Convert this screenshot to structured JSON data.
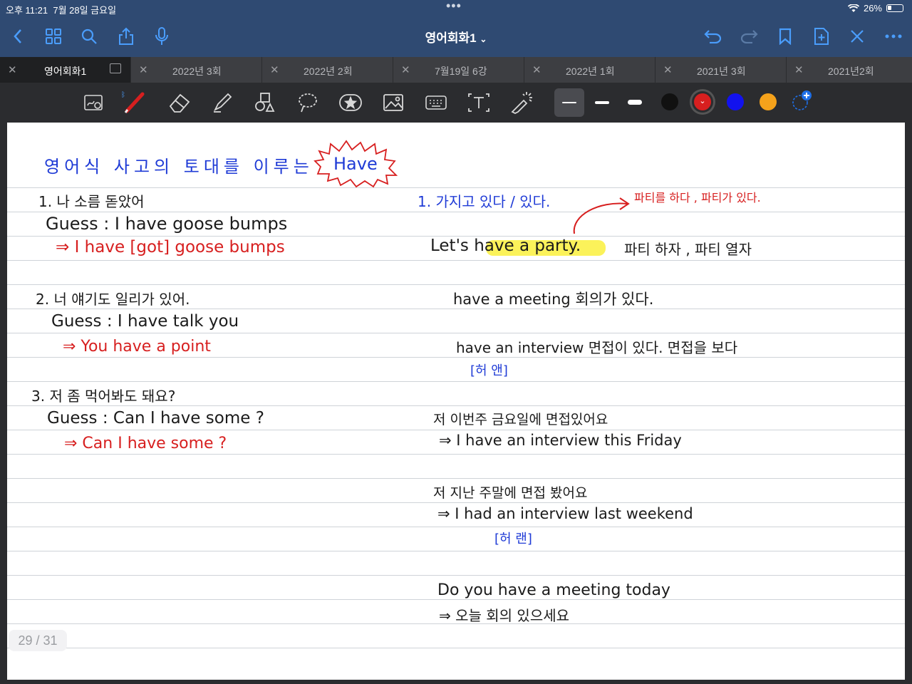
{
  "status": {
    "time": "오후 11:21",
    "date": "7월 28일 금요일",
    "battery": "26%",
    "battery_level": 0.26
  },
  "toolbar": {
    "title": "영어회화1",
    "title_chevron": "⌄"
  },
  "tabs": [
    {
      "label": "영어회화1",
      "active": true
    },
    {
      "label": "2022년 3회"
    },
    {
      "label": "2022년 2회"
    },
    {
      "label": "7월19일 6강"
    },
    {
      "label": "2022년 1회"
    },
    {
      "label": "2021년 3회"
    },
    {
      "label": "2021년2회"
    }
  ],
  "pen_colors": [
    "#111111",
    "#d71f1f",
    "#1212ee",
    "#f5a21b"
  ],
  "note": {
    "title": "영어식 사고의 토대를 이루는",
    "title_badge": "Have",
    "left": [
      {
        "q": "1. 나 소름 돋았어",
        "guess": "Guess : I have goose bumps",
        "answer": "⇒ I have [got] goose bumps"
      },
      {
        "q": "2. 너 얘기도 일리가 있어.",
        "guess": "Guess : I have talk you",
        "answer": "⇒ You have a point"
      },
      {
        "q": "3. 저 좀 먹어봐도 돼요?",
        "guess": "Guess : Can I have some ?",
        "answer": "⇒ Can I have some ?"
      }
    ],
    "right": {
      "heading": "1. 가지고 있다 / 있다.",
      "party_note": "파티를 하다 , 파티가 있다.",
      "party_en": "Let's have a party.",
      "party_ko": "파티 하자 , 파티 열자",
      "meeting": "have a meeting 회의가 있다.",
      "interview": "have an interview 면접이 있다. 면접을 보다",
      "an_pron": "[허 앤]",
      "ex1_ko": "저 이번주 금요일에 면접있어요",
      "ex1_en": "⇒ I have an interview this Friday",
      "ex2_ko": "저 지난 주말에 면접 봤어요",
      "ex2_en": "⇒ I had an interview last weekend",
      "had_pron": "[허 랜]",
      "ex3_en": "Do you have a meeting today",
      "ex3_ko": "⇒ 오늘 회의 있으세요"
    }
  },
  "pager": "29 / 31"
}
